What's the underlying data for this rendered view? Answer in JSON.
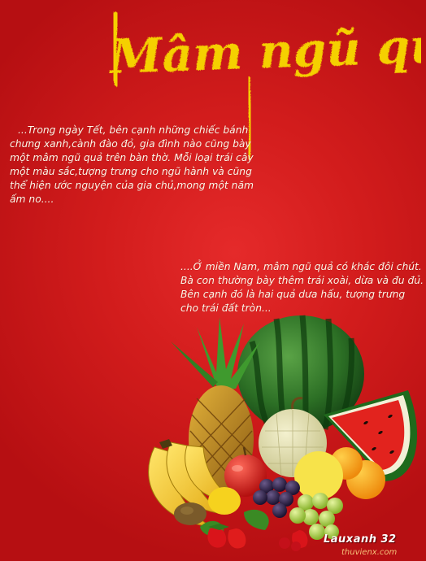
{
  "title": "Mâm ngũ quả",
  "paragraph_1": "...Trong ngày Tết, bên cạnh  những chiếc bánh chưng xanh,cành đào đỏ, gia đình  nào cũng bày một mâm ngũ quả trên bàn thờ. Mỗi  loại trái cây một màu sắc,tượng trưng cho ngũ hành và cũng thể hiện ước nguyện của gia chủ,mong một năm ấm no....",
  "paragraph_2": "....Ở miền Nam, mâm ngũ quả có khác đôi chút. Bà con thường bày thêm trái xoài, dừa và đu đủ. Bên  cạnh  đó là hai  quả dưa  hấu, tượng trưng cho trái đất tròn...",
  "signature": "Lauxanh 32",
  "watermark": "thuvienx.com",
  "colors": {
    "background": "#d21c1c",
    "title": "#f5d000",
    "text": "#fff6e8"
  },
  "fruits": [
    "watermelon",
    "watermelon-slice",
    "pineapple",
    "bananas",
    "cantaloupe",
    "oranges",
    "apple",
    "grapes",
    "kiwi",
    "strawberries",
    "lemon"
  ]
}
